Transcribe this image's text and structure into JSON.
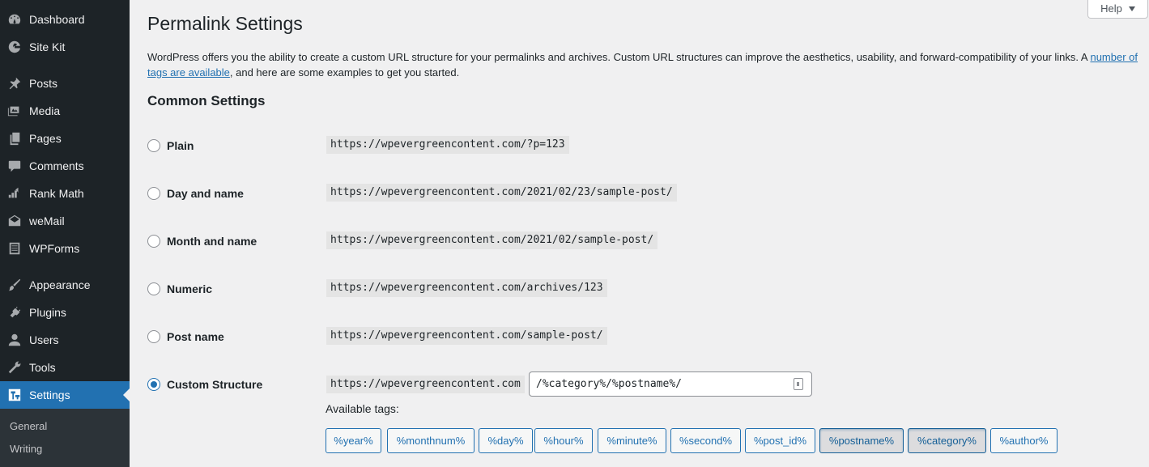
{
  "sidebar": {
    "items": [
      {
        "label": "Dashboard",
        "icon": "dashboard-icon"
      },
      {
        "label": "Site Kit",
        "icon": "site-kit-icon"
      },
      {
        "label": "Posts",
        "icon": "pin-icon"
      },
      {
        "label": "Media",
        "icon": "media-icon"
      },
      {
        "label": "Pages",
        "icon": "pages-icon"
      },
      {
        "label": "Comments",
        "icon": "comments-icon"
      },
      {
        "label": "Rank Math",
        "icon": "rank-math-icon"
      },
      {
        "label": "weMail",
        "icon": "wemail-icon"
      },
      {
        "label": "WPForms",
        "icon": "wpforms-icon"
      },
      {
        "label": "Appearance",
        "icon": "brush-icon"
      },
      {
        "label": "Plugins",
        "icon": "plug-icon"
      },
      {
        "label": "Users",
        "icon": "user-icon"
      },
      {
        "label": "Tools",
        "icon": "wrench-icon"
      },
      {
        "label": "Settings",
        "icon": "settings-icon"
      }
    ],
    "submenu": [
      "General",
      "Writing"
    ]
  },
  "help": {
    "label": "Help"
  },
  "page": {
    "title": "Permalink Settings",
    "intro_before": "WordPress offers you the ability to create a custom URL structure for your permalinks and archives. Custom URL structures can improve the aesthetics, usability, and forward-compatibility of your links. A ",
    "intro_link": "number of tags are available",
    "intro_after": ", and here are some examples to get you started.",
    "section_title": "Common Settings"
  },
  "options": [
    {
      "label": "Plain",
      "example": "https://wpevergreencontent.com/?p=123",
      "checked": false
    },
    {
      "label": "Day and name",
      "example": "https://wpevergreencontent.com/2021/02/23/sample-post/",
      "checked": false
    },
    {
      "label": "Month and name",
      "example": "https://wpevergreencontent.com/2021/02/sample-post/",
      "checked": false
    },
    {
      "label": "Numeric",
      "example": "https://wpevergreencontent.com/archives/123",
      "checked": false
    },
    {
      "label": "Post name",
      "example": "https://wpevergreencontent.com/sample-post/",
      "checked": false
    },
    {
      "label": "Custom Structure",
      "example": "https://wpevergreencontent.com",
      "checked": true
    }
  ],
  "custom": {
    "value": "/%category%/%postname%/",
    "available_label": "Available tags:",
    "tags": [
      {
        "label": "%year%",
        "pressed": false
      },
      {
        "label": "%monthnum%",
        "pressed": false
      },
      {
        "label": "%day%",
        "pressed": false
      },
      {
        "label": "%hour%",
        "pressed": false
      },
      {
        "label": "%minute%",
        "pressed": false
      },
      {
        "label": "%second%",
        "pressed": false
      },
      {
        "label": "%post_id%",
        "pressed": false
      },
      {
        "label": "%postname%",
        "pressed": true
      },
      {
        "label": "%category%",
        "pressed": true
      },
      {
        "label": "%author%",
        "pressed": false
      }
    ]
  }
}
